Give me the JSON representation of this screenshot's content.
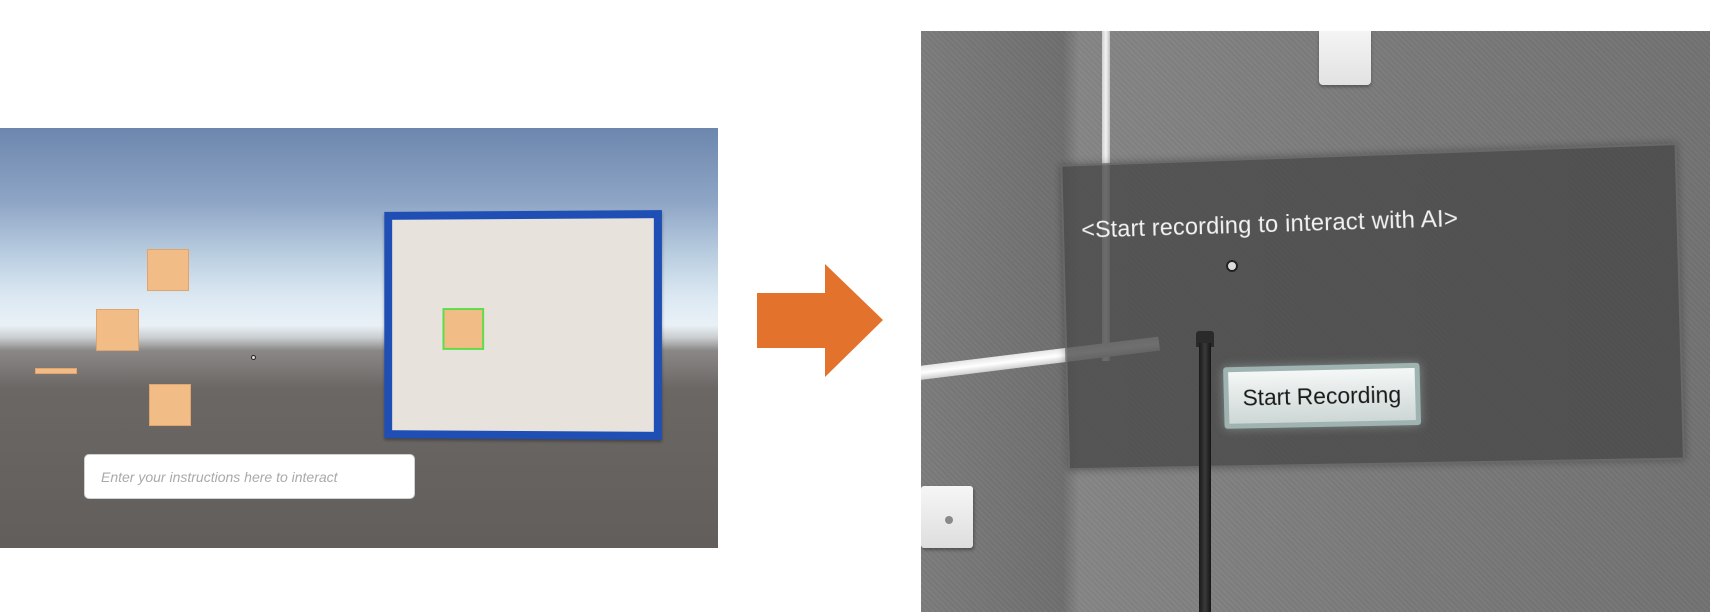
{
  "left_scene": {
    "input_placeholder": "Enter your instructions here to interact",
    "sticky_notes": [
      {
        "title": "",
        "body": ""
      },
      {
        "title": "",
        "body": ""
      },
      {
        "title": "",
        "body": ""
      },
      {
        "title": "",
        "body": ""
      },
      {
        "title": "",
        "body": ""
      }
    ]
  },
  "arrow": {
    "color": "#e2722c"
  },
  "right_scene": {
    "prompt_text": "<Start recording to interact with AI>",
    "start_button_label": "Start Recording"
  },
  "colors": {
    "board_frame": "#1f4fb4",
    "sticky_note": "#f2bc87",
    "selected_outline": "#5fdc4a"
  }
}
